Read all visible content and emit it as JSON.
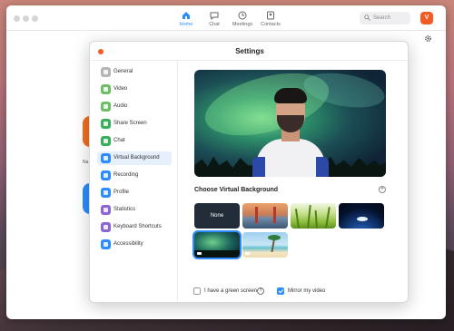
{
  "topbar": {
    "nav": [
      {
        "label": "Home",
        "icon": "home-icon"
      },
      {
        "label": "Chat",
        "icon": "chat-icon"
      },
      {
        "label": "Meetings",
        "icon": "clock-icon"
      },
      {
        "label": "Contacts",
        "icon": "contacts-icon"
      }
    ],
    "search_placeholder": "Search",
    "avatar_initial": "V",
    "avatar_color": "#f35b25"
  },
  "background_text": "Na",
  "settings": {
    "title": "Settings",
    "sidebar": [
      {
        "label": "General",
        "color": "#b5b5b5"
      },
      {
        "label": "Video",
        "color": "#6dc065"
      },
      {
        "label": "Audio",
        "color": "#6dc065"
      },
      {
        "label": "Share Screen",
        "color": "#3aae5a"
      },
      {
        "label": "Chat",
        "color": "#3aae5a"
      },
      {
        "label": "Virtual Background",
        "color": "#2d8cff"
      },
      {
        "label": "Recording",
        "color": "#2d8cff"
      },
      {
        "label": "Profile",
        "color": "#2d8cff"
      },
      {
        "label": "Statistics",
        "color": "#8b67d6"
      },
      {
        "label": "Keyboard Shortcuts",
        "color": "#8b67d6"
      },
      {
        "label": "Accessibility",
        "color": "#2d8cff"
      }
    ],
    "active_item": "Virtual Background",
    "choose_label": "Choose Virtual Background",
    "none_label": "None",
    "green_screen_label": "I have a green screen",
    "green_screen_checked": false,
    "mirror_label": "Mirror my video",
    "mirror_checked": true,
    "accent_color": "#2d8cff"
  }
}
